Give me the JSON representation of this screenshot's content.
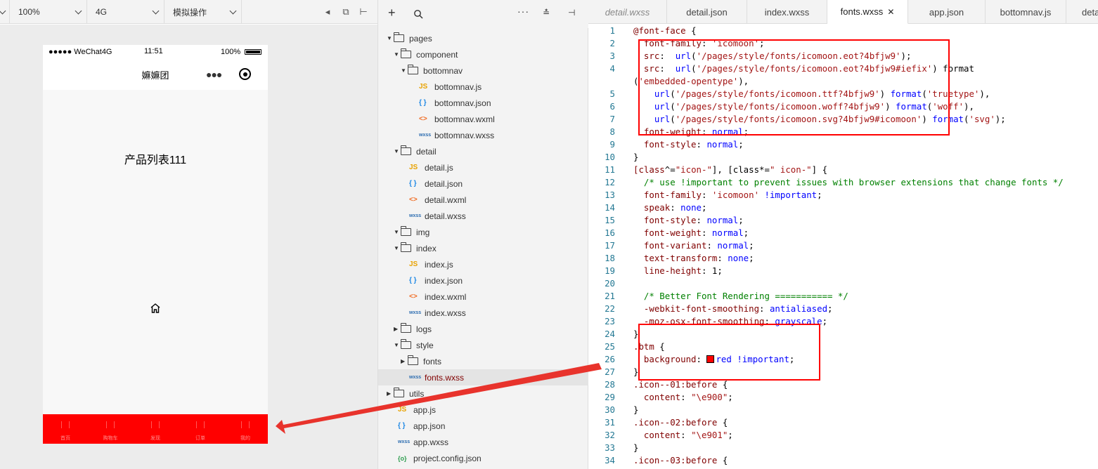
{
  "toolbar": {
    "zoom": "100%",
    "network": "4G",
    "simulate": "模拟操作"
  },
  "phone": {
    "carrier": "●●●●● WeChat4G",
    "time": "11:51",
    "battery": "100%",
    "nav_title": "嫲嫲团",
    "product_title": "产品列表111",
    "tabs": [
      "首页",
      "购物车",
      "发现",
      "订单",
      "我的"
    ],
    "accent": "#ff0000"
  },
  "tree": {
    "items": [
      {
        "label": "pages",
        "type": "folder",
        "open": true
      },
      {
        "label": "component",
        "type": "folder",
        "open": true
      },
      {
        "label": "bottomnav",
        "type": "folder",
        "open": true
      },
      {
        "label": "bottomnav.js",
        "type": "js"
      },
      {
        "label": "bottomnav.json",
        "type": "json"
      },
      {
        "label": "bottomnav.wxml",
        "type": "wxml"
      },
      {
        "label": "bottomnav.wxss",
        "type": "wxss"
      },
      {
        "label": "detail",
        "type": "folder",
        "open": true
      },
      {
        "label": "detail.js",
        "type": "js"
      },
      {
        "label": "detail.json",
        "type": "json"
      },
      {
        "label": "detail.wxml",
        "type": "wxml"
      },
      {
        "label": "detail.wxss",
        "type": "wxss"
      },
      {
        "label": "img",
        "type": "folder",
        "open": true
      },
      {
        "label": "index",
        "type": "folder",
        "open": true
      },
      {
        "label": "index.js",
        "type": "js"
      },
      {
        "label": "index.json",
        "type": "json"
      },
      {
        "label": "index.wxml",
        "type": "wxml"
      },
      {
        "label": "index.wxss",
        "type": "wxss"
      },
      {
        "label": "logs",
        "type": "folder",
        "open": false
      },
      {
        "label": "style",
        "type": "folder",
        "open": true
      },
      {
        "label": "fonts",
        "type": "folder",
        "open": false
      },
      {
        "label": "fonts.wxss",
        "type": "wxss",
        "selected": true
      },
      {
        "label": "utils",
        "type": "folder",
        "open": false
      },
      {
        "label": "app.js",
        "type": "js"
      },
      {
        "label": "app.json",
        "type": "json"
      },
      {
        "label": "app.wxss",
        "type": "wxss"
      },
      {
        "label": "project.config.json",
        "type": "cfg"
      }
    ]
  },
  "icons": {
    "js": "JS",
    "json": "{ }",
    "wxml": "<>",
    "wxss": "wxss",
    "cfg": "{o}"
  },
  "tabs": [
    "detail.wxss",
    "detail.json",
    "index.wxss",
    "fonts.wxss",
    "app.json",
    "bottomnav.js",
    "deta"
  ],
  "active_tab": "fonts.wxss",
  "code": [
    "@font-face {",
    "  font-family: 'icomoon';",
    "  src:  url('/pages/style/fonts/icomoon.eot?4bfjw9');",
    "  src:  url('/pages/style/fonts/icomoon.eot?4bfjw9#iefix') format",
    "('embedded-opentype'),",
    "    url('/pages/style/fonts/icomoon.ttf?4bfjw9') format('truetype'),",
    "    url('/pages/style/fonts/icomoon.woff?4bfjw9') format('woff'),",
    "    url('/pages/style/fonts/icomoon.svg?4bfjw9#icomoon') format('svg');",
    "  font-weight: normal;",
    "  font-style: normal;",
    "}",
    "[class^=\"icon-\"], [class*=\" icon-\"] {",
    "  /* use !important to prevent issues with browser extensions that change fonts */",
    "  font-family: 'icomoon' !important;",
    "  speak: none;",
    "  font-style: normal;",
    "  font-weight: normal;",
    "  font-variant: normal;",
    "  text-transform: none;",
    "  line-height: 1;",
    "",
    "  /* Better Font Rendering =========== */",
    "  -webkit-font-smoothing: antialiased;",
    "  -moz-osx-font-smoothing: grayscale;",
    "}",
    ".btm {",
    "  background: red !important;",
    "}",
    ".icon--01:before {",
    "  content: \"\\e900\";",
    "}",
    ".icon--02:before {",
    "  content: \"\\e901\";",
    "}",
    ".icon--03:before {"
  ],
  "line_numbers": [
    "1",
    "2",
    "3",
    "4",
    "",
    "5",
    "6",
    "7",
    "8",
    "9",
    "10",
    "11",
    "12",
    "13",
    "14",
    "15",
    "16",
    "17",
    "18",
    "19",
    "20",
    "21",
    "22",
    "23",
    "24",
    "25",
    "26",
    "27",
    "28",
    "29",
    "30",
    "31",
    "32",
    "33",
    "34"
  ]
}
